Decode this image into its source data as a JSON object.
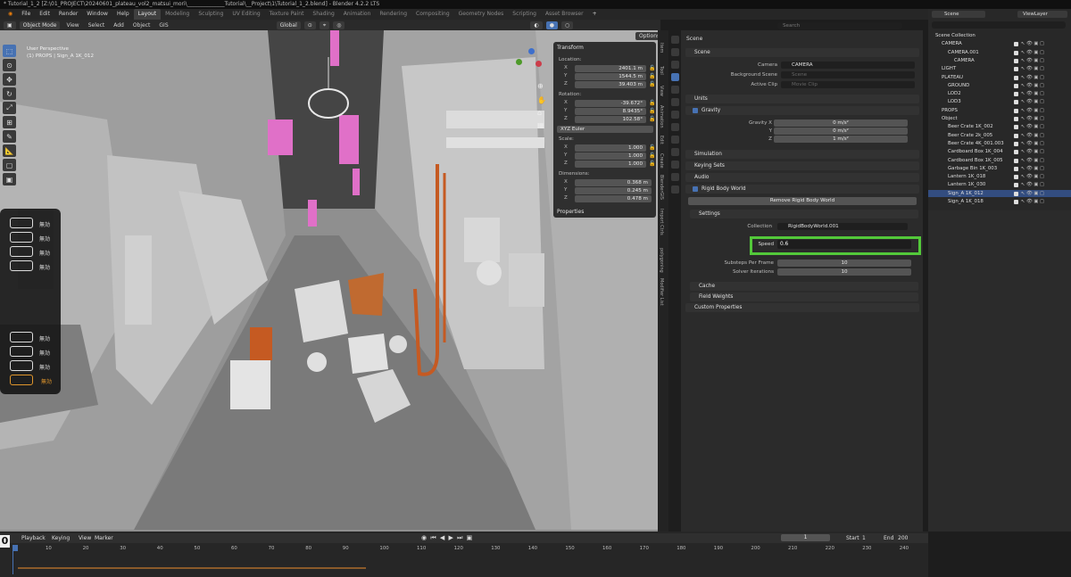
{
  "titlebar": {
    "text": "* Tutorial_1_2 [Z:\\01_PROJECT\\20240601_plateau_vol2_matsui_mori\\______________Tutorial\\__Project\\1\\Tutorial_1_2.blend] - Blender 4.2.2 LTS"
  },
  "menus": [
    "File",
    "Edit",
    "Render",
    "Window",
    "Help"
  ],
  "workspaces": [
    {
      "label": "Layout",
      "active": true
    },
    {
      "label": "Modeling",
      "active": false
    },
    {
      "label": "Sculpting",
      "active": false
    },
    {
      "label": "UV Editing",
      "active": false
    },
    {
      "label": "Texture Paint",
      "active": false
    },
    {
      "label": "Shading",
      "active": false
    },
    {
      "label": "Animation",
      "active": false
    },
    {
      "label": "Rendering",
      "active": false
    },
    {
      "label": "Compositing",
      "active": false
    },
    {
      "label": "Geometry Nodes",
      "active": false
    },
    {
      "label": "Scripting",
      "active": false
    },
    {
      "label": "Asset Browser",
      "active": false
    }
  ],
  "viewport_header": {
    "mode": "Object Mode",
    "menus": [
      "View",
      "Select",
      "Add",
      "Object",
      "GIS"
    ],
    "orientation": "Global",
    "options": "Options"
  },
  "viewport": {
    "perspective": "User Perspective",
    "object_info": "(1) PROPS | Sign_A 1K_012"
  },
  "key_overlay": {
    "top_labels": [
      "無効",
      "無効",
      "無効",
      "無効"
    ],
    "bottom_labels": [
      "無効",
      "無効",
      "無効",
      "無効"
    ],
    "active_color": "#e0962c"
  },
  "transform_panel": {
    "header": "Transform",
    "location_label": "Location:",
    "location": [
      {
        "axis": "X",
        "value": "2401.1 m"
      },
      {
        "axis": "Y",
        "value": "1544.5 m"
      },
      {
        "axis": "Z",
        "value": "39.403 m"
      }
    ],
    "rotation_label": "Rotation:",
    "rotation": [
      {
        "axis": "X",
        "value": "-39.672°"
      },
      {
        "axis": "Y",
        "value": "8.9435°"
      },
      {
        "axis": "Z",
        "value": "102.58°"
      }
    ],
    "rotation_mode": "XYZ Euler",
    "scale_label": "Scale:",
    "scale": [
      {
        "axis": "X",
        "value": "1.000"
      },
      {
        "axis": "Y",
        "value": "1.000"
      },
      {
        "axis": "Z",
        "value": "1.000"
      }
    ],
    "dimensions_label": "Dimensions:",
    "dimensions": [
      {
        "axis": "X",
        "value": "0.368 m"
      },
      {
        "axis": "Y",
        "value": "0.245 m"
      },
      {
        "axis": "Z",
        "value": "0.478 m"
      }
    ],
    "properties": "Properties"
  },
  "side_tabs": [
    "Item",
    "Tool",
    "View",
    "Animation",
    "Edit",
    "Create",
    "BlenderGIS",
    "Import Ctrls",
    "polygoning",
    "Modifier List"
  ],
  "properties": {
    "search_placeholder": "Search",
    "breadcrumb": "Scene",
    "scene_section": "Scene",
    "camera_label": "Camera",
    "camera_value": "CAMERA",
    "bg_scene_label": "Background Scene",
    "bg_scene_value": "Scene",
    "active_clip_label": "Active Clip",
    "active_clip_value": "Movie Clip",
    "units_section": "Units",
    "gravity_section": "Gravity",
    "gravity_x_label": "Gravity X",
    "gravity_x": "0 m/s²",
    "gravity_y_label": "Y",
    "gravity_y": "0 m/s²",
    "gravity_z_label": "Z",
    "gravity_z": "1 m/s²",
    "simulation_section": "Simulation",
    "keying_sets_section": "Keying Sets",
    "audio_section": "Audio",
    "rigid_body_section": "Rigid Body World",
    "remove_rigid_body": "Remove Rigid Body World",
    "settings_section": "Settings",
    "collection_label": "Collection",
    "collection_value": "RigidBodyWorld.001",
    "speed_label": "Speed",
    "speed_value": "0.6",
    "substeps_label": "Substeps Per Frame",
    "substeps_value": "10",
    "solver_label": "Solver Iterations",
    "solver_value": "10",
    "cache_section": "Cache",
    "field_weights_section": "Field Weights",
    "custom_props_section": "Custom Properties"
  },
  "outliner": {
    "scene_selector": "Scene",
    "viewlayer": "ViewLayer",
    "items": [
      {
        "label": "Scene Collection",
        "indent": 0
      },
      {
        "label": "CAMERA",
        "indent": 1
      },
      {
        "label": "CAMERA.001",
        "indent": 2
      },
      {
        "label": "CAMERA",
        "indent": 3
      },
      {
        "label": "LIGHT",
        "indent": 1
      },
      {
        "label": "PLATEAU",
        "indent": 1
      },
      {
        "label": "GROUND",
        "indent": 2
      },
      {
        "label": "LOD2",
        "indent": 2
      },
      {
        "label": "LOD3",
        "indent": 2
      },
      {
        "label": "PROPS",
        "indent": 1
      },
      {
        "label": "Object",
        "indent": 1
      },
      {
        "label": "Beer Crate 1K_002",
        "indent": 2
      },
      {
        "label": "Beer Crate 2k_005",
        "indent": 2
      },
      {
        "label": "Beer Crate 4K_001.003",
        "indent": 2
      },
      {
        "label": "Cardboard Box 1K_004",
        "indent": 2
      },
      {
        "label": "Cardboard Box 1K_005",
        "indent": 2
      },
      {
        "label": "Garbage Bin 1K_003",
        "indent": 2
      },
      {
        "label": "Lantern 1K_018",
        "indent": 2
      },
      {
        "label": "Lantern 1K_030",
        "indent": 2
      },
      {
        "label": "Sign_A 1K_012",
        "indent": 2
      },
      {
        "label": "Sign_A 1K_018",
        "indent": 2
      }
    ]
  },
  "timeline": {
    "current_frame": "0",
    "menus": [
      "Playback",
      "Keying",
      "View",
      "Marker"
    ],
    "frame_field": "1",
    "start_label": "Start",
    "start_value": "1",
    "end_label": "End",
    "end_value": "200",
    "ticks": [
      "10",
      "20",
      "30",
      "40",
      "50",
      "60",
      "70",
      "80",
      "90",
      "100",
      "110",
      "120",
      "130",
      "140",
      "150",
      "160",
      "170",
      "180",
      "190",
      "200",
      "210",
      "220",
      "230",
      "240"
    ]
  },
  "colors": {
    "highlight": "#53c93a",
    "accent": "#4772b3",
    "pink_lights": "#e070c8",
    "orange_props": "#c55a22"
  }
}
